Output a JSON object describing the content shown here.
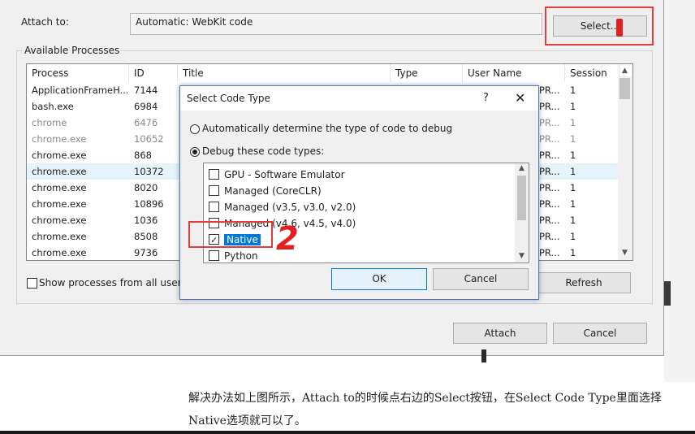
{
  "main_dialog": {
    "attach_to_label": "Attach to:",
    "attach_to_value": "Automatic: WebKit code",
    "select_button": "Select...",
    "available_processes_label": "Available Processes",
    "columns": [
      "Process",
      "ID",
      "Title",
      "Type",
      "User Name",
      "Session"
    ],
    "processes": [
      {
        "process": "ApplicationFrameH...",
        "id": "7144",
        "user": "PR...",
        "session": "1",
        "dim": false
      },
      {
        "process": "bash.exe",
        "id": "6984",
        "user": "PR...",
        "session": "1",
        "dim": false
      },
      {
        "process": "chrome",
        "id": "6476",
        "user": "PR...",
        "session": "1",
        "dim": true
      },
      {
        "process": "chrome.exe",
        "id": "10652",
        "user": "PR...",
        "session": "1",
        "dim": true
      },
      {
        "process": "chrome.exe",
        "id": "868",
        "user": "PR...",
        "session": "1",
        "dim": false
      },
      {
        "process": "chrome.exe",
        "id": "10372",
        "user": "PR...",
        "session": "1",
        "dim": false,
        "selected": true
      },
      {
        "process": "chrome.exe",
        "id": "8020",
        "user": "PR...",
        "session": "1",
        "dim": false
      },
      {
        "process": "chrome.exe",
        "id": "10896",
        "user": "PR...",
        "session": "1",
        "dim": false
      },
      {
        "process": "chrome.exe",
        "id": "1036",
        "user": "PR...",
        "session": "1",
        "dim": false
      },
      {
        "process": "chrome.exe",
        "id": "8508",
        "user": "PR...",
        "session": "1",
        "dim": false
      },
      {
        "process": "chrome.exe",
        "id": "9736",
        "user": "PR...",
        "session": "1",
        "dim": false
      }
    ],
    "show_all_users_label": "Show processes from all users",
    "refresh_button": "Refresh",
    "attach_button": "Attach",
    "cancel_button": "Cancel"
  },
  "select_code_type": {
    "title": "Select Code Type",
    "help_glyph": "?",
    "close_glyph": "✕",
    "radio_auto_label": "Automatically determine the type of code to debug",
    "radio_debug_label": "Debug these code types:",
    "code_types": [
      {
        "label": "GPU - Software Emulator",
        "checked": false
      },
      {
        "label": "Managed (CoreCLR)",
        "checked": false
      },
      {
        "label": "Managed (v3.5, v3.0, v2.0)",
        "checked": false
      },
      {
        "label": "Managed (v4.6, v4.5, v4.0)",
        "checked": false
      },
      {
        "label": "Native",
        "checked": true,
        "highlighted": true
      },
      {
        "label": "Python",
        "checked": false
      }
    ],
    "ok_button": "OK",
    "cancel_button": "Cancel"
  },
  "annotation": {
    "step_number": "2",
    "mark_color": "#e41f1f"
  },
  "caption": {
    "text": "解决办法如上图所示，Attach to的时候点右边的Select按钮，在Select Code Type里面选择Native选项就可以了。"
  }
}
